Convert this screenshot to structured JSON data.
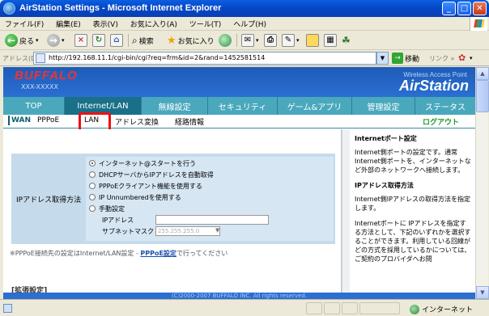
{
  "window": {
    "title": "AirStation Settings - Microsoft Internet Explorer",
    "btn_min": "_",
    "btn_max": "□",
    "btn_close": "✕"
  },
  "menu": [
    "ファイル(F)",
    "編集(E)",
    "表示(V)",
    "お気に入り(A)",
    "ツール(T)",
    "ヘルプ(H)"
  ],
  "toolbar": {
    "back": "戻る",
    "search": "検索",
    "favorites": "お気に入り"
  },
  "address": {
    "label": "アドレス(D)",
    "url": "http://192.168.11.1/cgi-bin/cgi?req=frm&id=2&rand=1452581514",
    "go": "移動",
    "links": "リンク »"
  },
  "brand": {
    "logo": "BUFFALO",
    "model": "XXX-XXXXX",
    "wal": "Wireless Access Point",
    "product": "AirStation"
  },
  "tabs": [
    "TOP",
    "Internet/LAN",
    "無線設定",
    "セキュリティ",
    "ゲーム&アプリ",
    "管理設定",
    "ステータス"
  ],
  "subnav": {
    "items": [
      "WAN",
      "PPPoE",
      "LAN",
      "アドレス変換",
      "経路情報"
    ],
    "logout": "ログアウト"
  },
  "ip_section": {
    "label": "IPアドレス取得方法",
    "options": [
      "インターネット@スタートを行う",
      "DHCPサーバからIPアドレスを自動取得",
      "PPPoEクライアント機能を使用する",
      "IP Unnumberedを使用する",
      "手動設定"
    ],
    "selected_index": 0,
    "ip_label": "IPアドレス",
    "ip_value": "",
    "mask_label": "サブネットマスク",
    "mask_value": "255.255.255.0"
  },
  "note": {
    "before": "※PPPoE接続先の設定はInternet/LAN設定 - ",
    "link": "PPPoE設定",
    "after": "で行ってください"
  },
  "extended": "[拡張設定]",
  "help": {
    "h1": "Internetポート設定",
    "p1": "Internet側ポートの設定です。通常Internet側ポートを、インターネットなど外部のネットワークへ接続します。",
    "h2": "IPアドレス取得方法",
    "p2": "Internet側IPアドレスの取得方法を指定します。",
    "p3": "Internetポートに IPアドレスを指定する方法として、下記のいずれかを選択することができます。利用している回線がどの方式を採用しているかについては、ご契約のプロバイダへお問"
  },
  "footer": "(C)2000-2007 BUFFALO INC. All rights reserved.",
  "status": {
    "zone": "インターネット"
  }
}
